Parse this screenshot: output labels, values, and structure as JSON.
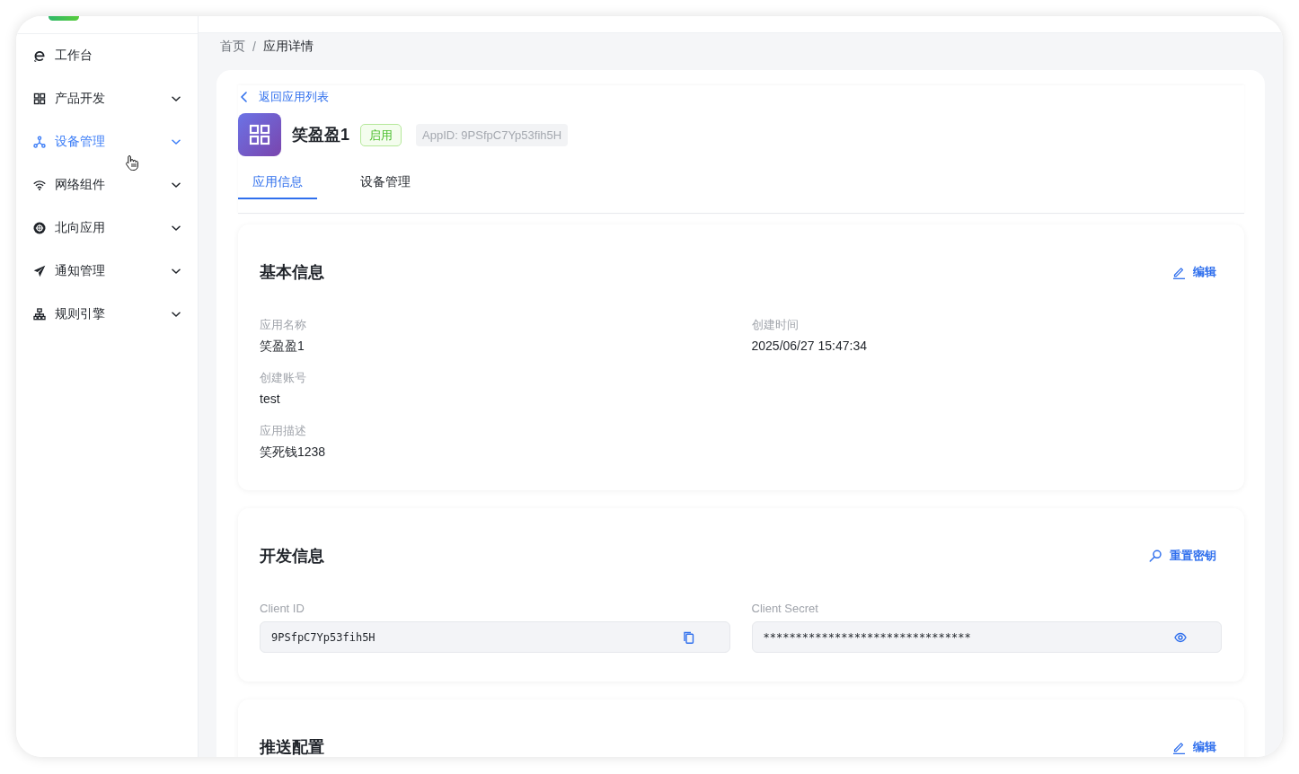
{
  "sidebar": {
    "items": [
      {
        "label": "工作台",
        "kind": "link",
        "selected": false
      },
      {
        "label": "产品开发",
        "kind": "group",
        "selected": false
      },
      {
        "label": "设备管理",
        "kind": "group",
        "selected": true
      },
      {
        "label": "网络组件",
        "kind": "group",
        "selected": false
      },
      {
        "label": "北向应用",
        "kind": "group",
        "selected": false
      },
      {
        "label": "通知管理",
        "kind": "group",
        "selected": false
      },
      {
        "label": "规则引擎",
        "kind": "group",
        "selected": false
      }
    ]
  },
  "breadcrumb": {
    "items": [
      "首页",
      "应用详情"
    ],
    "separator": "/"
  },
  "header": {
    "back_link": "返回应用列表",
    "app_name": "笑盈盈1",
    "status": {
      "label": "启用",
      "enabled": true
    },
    "app_id": "AppID: 9PSfpC7Yp53fih5H"
  },
  "tabs": [
    {
      "label": "应用信息",
      "selected": true
    },
    {
      "label": "设备管理",
      "selected": false
    }
  ],
  "sections": [
    {
      "kind": "info",
      "title": "基本信息",
      "action": {
        "kind": "edit",
        "label": "编辑"
      },
      "columns": [
        [
          {
            "label": "应用名称",
            "value": "笑盈盈1"
          },
          {
            "label": "创建账号",
            "value": "test"
          },
          {
            "label": "应用描述",
            "value": "笑死钱1238"
          }
        ],
        [
          {
            "label": "创建时间",
            "value": "2025/06/27 15:47:34"
          }
        ]
      ]
    },
    {
      "kind": "credentials",
      "title": "开发信息",
      "action": {
        "kind": "reset",
        "label": "重置密钥"
      },
      "fields": [
        {
          "label": "Client ID",
          "value": "9PSfpC7Yp53fih5H",
          "kind": "copy"
        },
        {
          "label": "Client Secret",
          "value": "********************************",
          "kind": "reveal"
        }
      ]
    },
    {
      "kind": "info",
      "title": "推送配置",
      "action": {
        "kind": "edit",
        "label": "编辑"
      }
    }
  ]
}
